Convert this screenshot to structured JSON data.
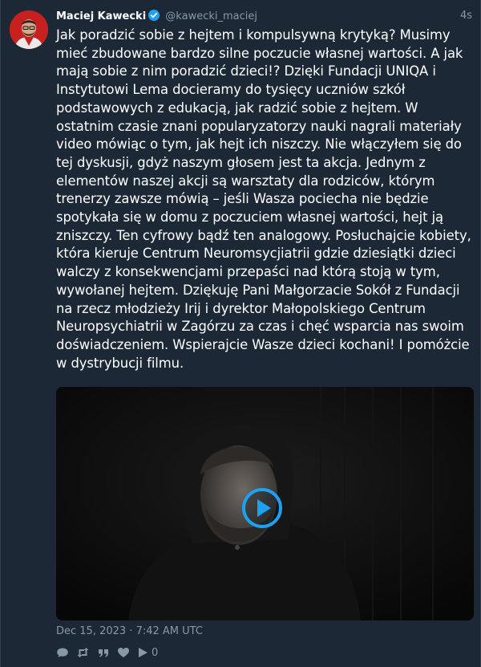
{
  "author": {
    "fullname": "Maciej Kawecki",
    "username": "@kawecki_maciej",
    "verified": true,
    "avatar_icon": "avatar-photo"
  },
  "time": "4s",
  "content": "Jak poradzić sobie z hejtem i kompulsywną krytyką? Musimy mieć zbudowane bardzo silne poczucie własnej wartości. A jak mają sobie z nim poradzić dzieci!? Dzięki Fundacji UNIQA i Instytutowi Lema docieramy do tysięcy uczniów szkół podstawowych z edukacją, jak radzić sobie z hejtem. W ostatnim czasie znani popularyzatorzy nauki nagrali materiały video mówiąc o tym, jak hejt ich niszczy. Nie włączyłem się do tej dyskusji, gdyż naszym głosem jest ta akcja. Jednym z elementów naszej akcji są warsztaty dla rodziców, którym trenerzy zawsze mówią – jeśli Wasza pociecha nie będzie spotykała się w domu z poczuciem własnej wartości, hejt ją zniszczy. Ten cyfrowy bądź ten analogowy. Posłuchajcie kobiety, która kieruje Centrum Neuromsycjiatrii gdzie dziesiątki dzieci walczy z konsekwencjami przepaści nad którą stoją w tym, wywołanej hejtem. Dziękuję Pani Małgorzacie Sokół z Fundacji na rzecz młodzieży Irij i dyrektor Małopolskiego Centrum Neuropsychiatrii w Zagórzu za czas i chęć wsparcia nas swoim doświadczeniem. Wspierajcie Wasze dzieci kochani! I pomóżcie w dystrybucji filmu.",
  "media": {
    "type": "video",
    "play_icon": "play-icon"
  },
  "date": "Dec 15, 2023 · 7:42 AM UTC",
  "actions": {
    "reply_icon": "reply-icon",
    "retweet_icon": "retweet-icon",
    "quote_icon": "quote-icon",
    "like_icon": "heart-icon",
    "views_icon": "play-views-icon",
    "views_count": "0"
  },
  "colors": {
    "background": "#1c2836",
    "text": "#ffffff",
    "muted": "#8899a6",
    "accent": "#1da1f2",
    "avatar_bg": "#c8201f"
  }
}
